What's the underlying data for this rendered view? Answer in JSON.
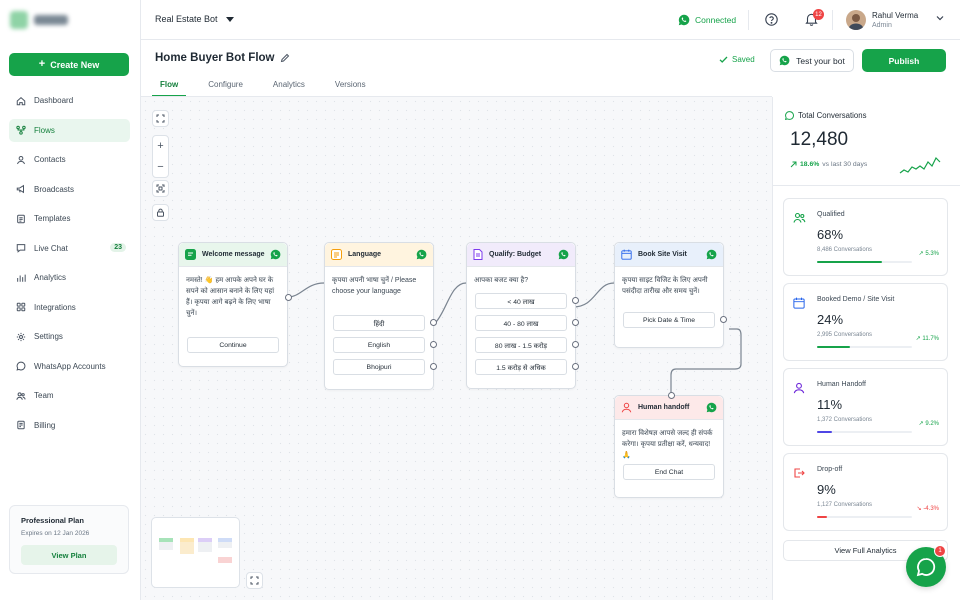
{
  "topbar": {
    "bot_name": "Real Estate Bot",
    "status": "Connected",
    "notification_count": "12",
    "user_name": "Rahul Verma",
    "user_role": "Admin"
  },
  "sidebar": {
    "create_label": "Create New",
    "items": [
      {
        "label": "Dashboard",
        "icon": "dashboard-icon"
      },
      {
        "label": "Flows",
        "icon": "flows-icon",
        "active": true
      },
      {
        "label": "Contacts",
        "icon": "contacts-icon"
      },
      {
        "label": "Broadcasts",
        "icon": "megaphone-icon"
      },
      {
        "label": "Templates",
        "icon": "templates-icon"
      },
      {
        "label": "Live Chat",
        "icon": "chat-icon",
        "badge": "23"
      },
      {
        "label": "Analytics",
        "icon": "analytics-icon"
      },
      {
        "label": "Integrations",
        "icon": "integrations-icon"
      },
      {
        "label": "Settings",
        "icon": "gear-icon"
      },
      {
        "label": "WhatsApp Accounts",
        "icon": "whatsapp-icon"
      },
      {
        "label": "Team",
        "icon": "team-icon"
      },
      {
        "label": "Billing",
        "icon": "billing-icon"
      }
    ],
    "plan": {
      "title": "Professional Plan",
      "expires": "Expires on 12 Jan 2026",
      "button": "View Plan"
    }
  },
  "flow": {
    "title": "Home Buyer Bot Flow",
    "saved": "Saved",
    "test_label": "Test your bot",
    "publish_label": "Publish",
    "tabs": [
      "Flow",
      "Configure",
      "Analytics",
      "Versions"
    ]
  },
  "nodes": {
    "welcome": {
      "title": "Welcome message",
      "text": "नमस्ते! 👋 हम आपके अपने घर के सपने को आसान बनाने के लिए यहां हैं। कृपया आगे बढ़ने के लिए भाषा चुनें।",
      "button": "Continue"
    },
    "language": {
      "title": "Language",
      "text": "कृपया अपनी भाषा चुनें / Please choose your language",
      "options": [
        "हिंदी",
        "English",
        "Bhojpuri"
      ]
    },
    "budget": {
      "title": "Qualify: Budget",
      "text": "आपका बजट क्या है?",
      "options": [
        "< 40 लाख",
        "40 - 80 लाख",
        "80 लाख - 1.5 करोड़",
        "1.5 करोड़ से अधिक"
      ]
    },
    "site_visit": {
      "title": "Book Site Visit",
      "text": "कृपया साइट विजिट के लिए अपनी पसंदीदा तारीख और समय चुनें।",
      "button": "Pick Date & Time"
    },
    "handoff": {
      "title": "Human handoff",
      "text": "हमारा विशेषज्ञ आपसे जल्द ही संपर्क करेगा। कृपया प्रतीक्षा करें, धन्यवाद! 🙏",
      "button": "End Chat"
    }
  },
  "stats": {
    "total_label": "Total Conversations",
    "total_value": "12,480",
    "trend_value": "18.6%",
    "trend_text": "vs last 30 days",
    "metrics": [
      {
        "label": "Qualified",
        "value": "68%",
        "conv": "8,486 Conversations",
        "change": "5.3%",
        "progress": 0.68,
        "color": "#16a34a",
        "icon": "team-icon"
      },
      {
        "label": "Booked Demo / Site Visit",
        "value": "24%",
        "conv": "2,995 Conversations",
        "change": "11.7%",
        "progress": 0.35,
        "color": "#16a34a",
        "icon": "calendar-icon"
      },
      {
        "label": "Human Handoff",
        "value": "11%",
        "conv": "1,372 Conversations",
        "change": "9.2%",
        "progress": 0.16,
        "color": "#4f46e5",
        "icon": "user-icon"
      },
      {
        "label": "Drop-off",
        "value": "9%",
        "conv": "1,127 Conversations",
        "change": "-4.3%",
        "progress": 0.11,
        "color": "#ef4444",
        "icon": "exit-icon"
      }
    ],
    "view_all": "View Full Analytics"
  },
  "chat_fab_badge": "1",
  "colors": {
    "brand": "#16a34a",
    "danger": "#ef4444",
    "indigo": "#4f46e5"
  }
}
